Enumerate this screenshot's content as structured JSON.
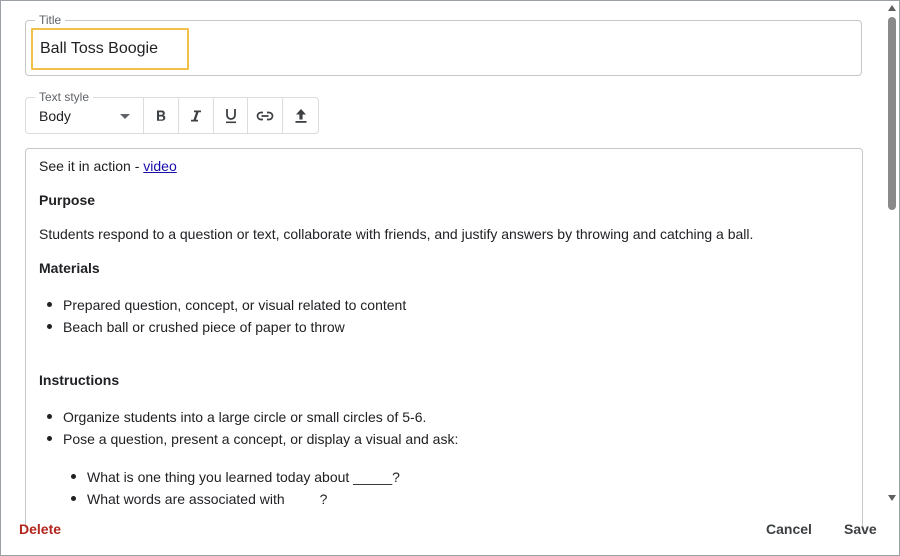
{
  "title_field": {
    "legend": "Title",
    "value": "Ball Toss Boogie"
  },
  "text_style": {
    "legend": "Text style",
    "selected": "Body",
    "buttons": [
      "bold-icon",
      "italic-icon",
      "underline-icon",
      "link-icon",
      "upload-icon"
    ]
  },
  "editor": {
    "intro_text": "See it in action - ",
    "intro_link": "video",
    "purpose_heading": "Purpose",
    "purpose_text": "Students respond to a question or text, collaborate with friends, and justify answers by throwing and catching a ball.",
    "materials_heading": "Materials",
    "materials": [
      "Prepared question, concept, or visual related to content",
      "Beach ball or crushed piece of paper to throw"
    ],
    "instructions_heading": "Instructions",
    "instructions": [
      "Organize students into a large circle or small circles of 5-6.",
      "Pose a question, present a concept, or display a visual and ask:"
    ],
    "sub_instructions": [
      "What is one thing you learned today about _____?",
      "What words are associated with         ?"
    ]
  },
  "footer": {
    "delete_label": "Delete",
    "cancel_label": "Cancel",
    "save_label": "Save"
  },
  "colors": {
    "focus_border": "#f0c04a",
    "delete": "#b3261e",
    "link": "#1a0dab"
  }
}
